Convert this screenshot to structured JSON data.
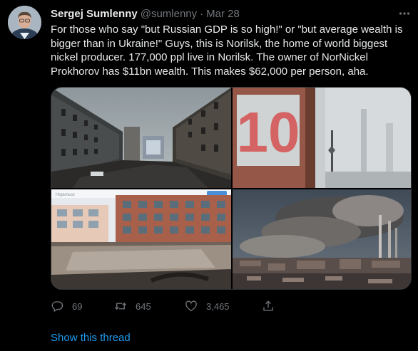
{
  "tweet": {
    "display_name": "Sergej Sumlenny",
    "handle": "@sumlenny",
    "separator": "·",
    "date": "Mar 28",
    "text": "For those who say \"but Russian GDP is so high!\" or \"but average wealth is bigger than in Ukraine!\" Guys, this is Norilsk, the home of world biggest nickel producer. 177,000 ppl live in Norilsk. The owner of NorNickel Prokhorov has $11bn wealth. This makes $62,000 per person, aha.",
    "media": [
      {
        "name": "photo-norilsk-courtyard"
      },
      {
        "name": "photo-building-number-10"
      },
      {
        "name": "photo-flooded-yard"
      },
      {
        "name": "photo-smoking-factory"
      }
    ],
    "photo_3_caption_snippet": "Норильск",
    "building_number": "10",
    "actions": {
      "reply_count": "69",
      "retweet_count": "645",
      "like_count": "3,465"
    },
    "show_thread": "Show this thread"
  },
  "colors": {
    "background": "#000000",
    "text_primary": "#e7e9ea",
    "text_secondary": "#71767b",
    "accent": "#1d9bf0"
  },
  "icons": [
    "more-icon",
    "reply-icon",
    "retweet-icon",
    "like-icon",
    "share-icon"
  ]
}
